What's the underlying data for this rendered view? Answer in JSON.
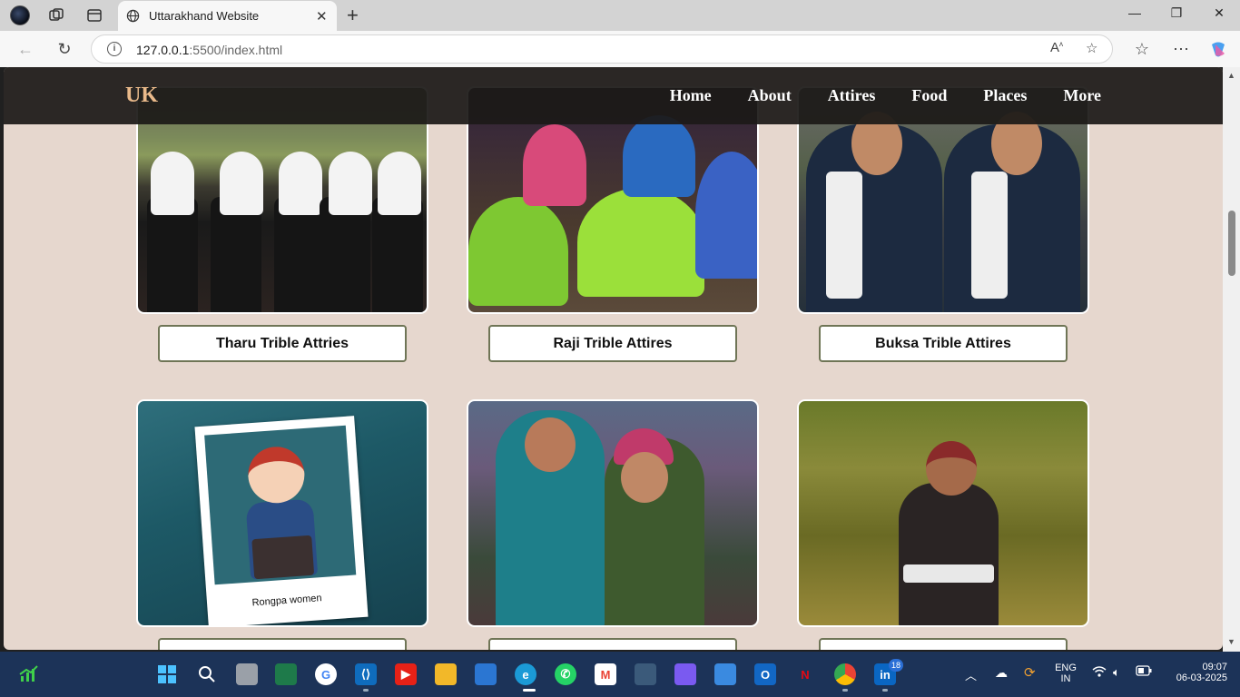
{
  "browser": {
    "tab_title": "Uttarakhand Website",
    "url_host": "127.0.0.1",
    "url_path": ":5500/index.html",
    "new_tab": "+",
    "close_tab": "✕"
  },
  "site": {
    "logo": "UK",
    "nav": [
      "Home",
      "About",
      "Attires",
      "Food",
      "Places",
      "More"
    ]
  },
  "cards": [
    {
      "label": "Tharu Trible Attries"
    },
    {
      "label": "Raji Trible Attires"
    },
    {
      "label": "Buksa Trible Attires"
    },
    {
      "label": "",
      "photo_caption": "Rongpa women"
    },
    {
      "label": ""
    },
    {
      "label": ""
    }
  ],
  "taskbar": {
    "lang": "ENG",
    "region": "IN",
    "time": "09:07",
    "date": "06-03-2025",
    "linkedin_badge": "18"
  },
  "colors": {
    "page_bg": "#e6d7ce",
    "nav_bg": "#1c1a18",
    "logo": "#e9b98a",
    "button_border": "#6f7556",
    "taskbar": "#1c3358"
  }
}
